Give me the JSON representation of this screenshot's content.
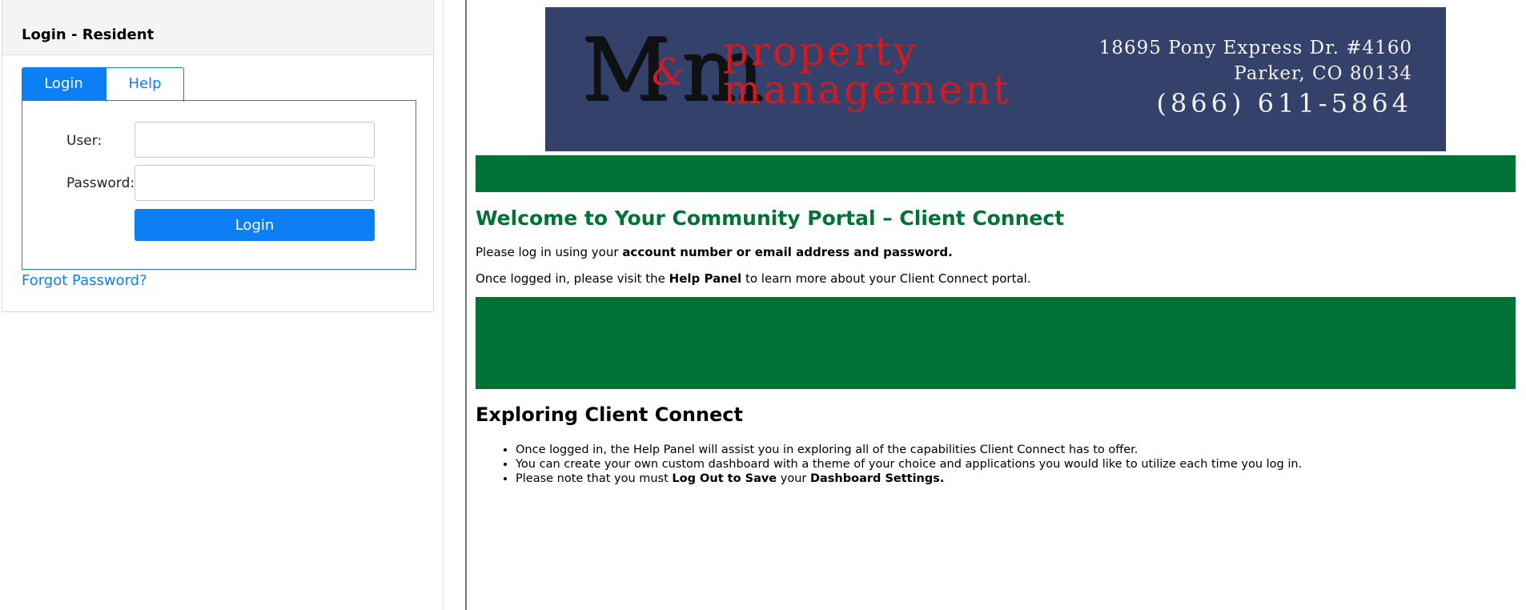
{
  "login_panel": {
    "title": "Login - Resident",
    "tabs": [
      {
        "label": "Login",
        "active": true
      },
      {
        "label": "Help",
        "active": false
      }
    ],
    "user_label": "User:",
    "user_value": "",
    "password_label": "Password:",
    "password_value": "",
    "login_button": "Login",
    "forgot_password": "Forgot Password?"
  },
  "banner": {
    "logo_letters": "M m",
    "logo_ampersand": "&",
    "logo_line1": "property",
    "logo_line2": "management",
    "street": "18695 Pony Express Dr. #4160",
    "city": "Parker, CO 80134",
    "phone": "(866) 611-5864"
  },
  "main": {
    "welcome_title": "Welcome to Your Community Portal – Client Connect",
    "line1_prefix": "Please log in using your ",
    "line1_bold": "account number or email address and password.",
    "line2_prefix": "Once logged in, please visit the ",
    "line2_bold": "Help Panel",
    "line2_suffix": " to learn more about your Client Connect portal.",
    "exploring_title": "Exploring Client Connect",
    "bullet1": "Once logged in, the Help Panel will assist you in exploring all of the capabilities Client Connect has to offer.",
    "bullet2": "You can create your own custom dashboard with a theme of your choice and applications you would like to utilize each time you log in.",
    "bullet3_prefix": "Please note that you must ",
    "bullet3_bold1": "Log Out to Save",
    "bullet3_mid": " your ",
    "bullet3_bold2": "Dashboard Settings."
  },
  "colors": {
    "accent_blue": "#0b7ff3",
    "brand_green": "#007236",
    "banner_navy": "#34426b",
    "logo_red": "#d21a1f"
  }
}
